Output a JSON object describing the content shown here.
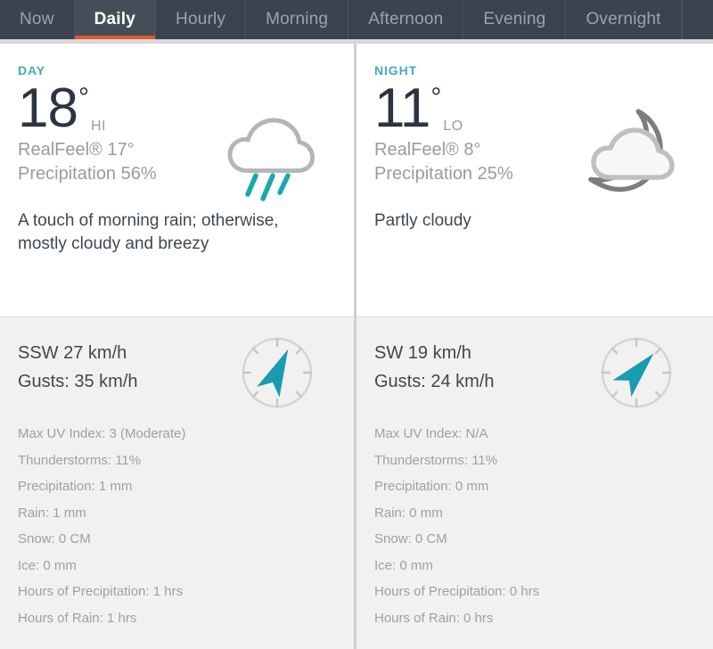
{
  "tabs": [
    {
      "label": "Now",
      "active": false
    },
    {
      "label": "Daily",
      "active": true
    },
    {
      "label": "Hourly",
      "active": false
    },
    {
      "label": "Morning",
      "active": false
    },
    {
      "label": "Afternoon",
      "active": false
    },
    {
      "label": "Evening",
      "active": false
    },
    {
      "label": "Overnight",
      "active": false
    }
  ],
  "colors": {
    "accent_orange": "#e4582a",
    "tabbar_bg": "#3b444e",
    "period_teal": "#4aa8bd",
    "compass_arrow": "#199cb0",
    "rain_teal": "#19a8ae",
    "temp_navy": "#2b3440"
  },
  "day": {
    "period": "DAY",
    "temp": "18",
    "degree": "°",
    "suffix": "HI",
    "realfeel": "RealFeel® 17°",
    "precipitation": "Precipitation 56%",
    "description": "A touch of morning rain; otherwise, mostly cloudy and breezy",
    "icon": "cloud-rain-icon",
    "wind": "SSW 27 km/h",
    "gusts": "Gusts: 35 km/h",
    "wind_icon": "compass-icon",
    "wind_arrow_deg": 25,
    "stats": [
      "Max UV Index: 3 (Moderate)",
      "Thunderstorms: 11%",
      "Precipitation: 1 mm",
      "Rain: 1 mm",
      "Snow: 0 CM",
      "Ice: 0 mm",
      "Hours of Precipitation: 1 hrs",
      "Hours of Rain: 1 hrs"
    ]
  },
  "night": {
    "period": "NIGHT",
    "temp": "11",
    "degree": "°",
    "suffix": "LO",
    "realfeel": "RealFeel® 8°",
    "precipitation": "Precipitation 25%",
    "description": "Partly cloudy",
    "icon": "moon-cloud-icon",
    "wind": "SW 19 km/h",
    "gusts": "Gusts: 24 km/h",
    "wind_icon": "compass-icon",
    "wind_arrow_deg": 42,
    "stats": [
      "Max UV Index: N/A",
      "Thunderstorms: 11%",
      "Precipitation: 0 mm",
      "Rain: 0 mm",
      "Snow: 0 CM",
      "Ice: 0 mm",
      "Hours of Precipitation: 0 hrs",
      "Hours of Rain: 0 hrs"
    ]
  }
}
